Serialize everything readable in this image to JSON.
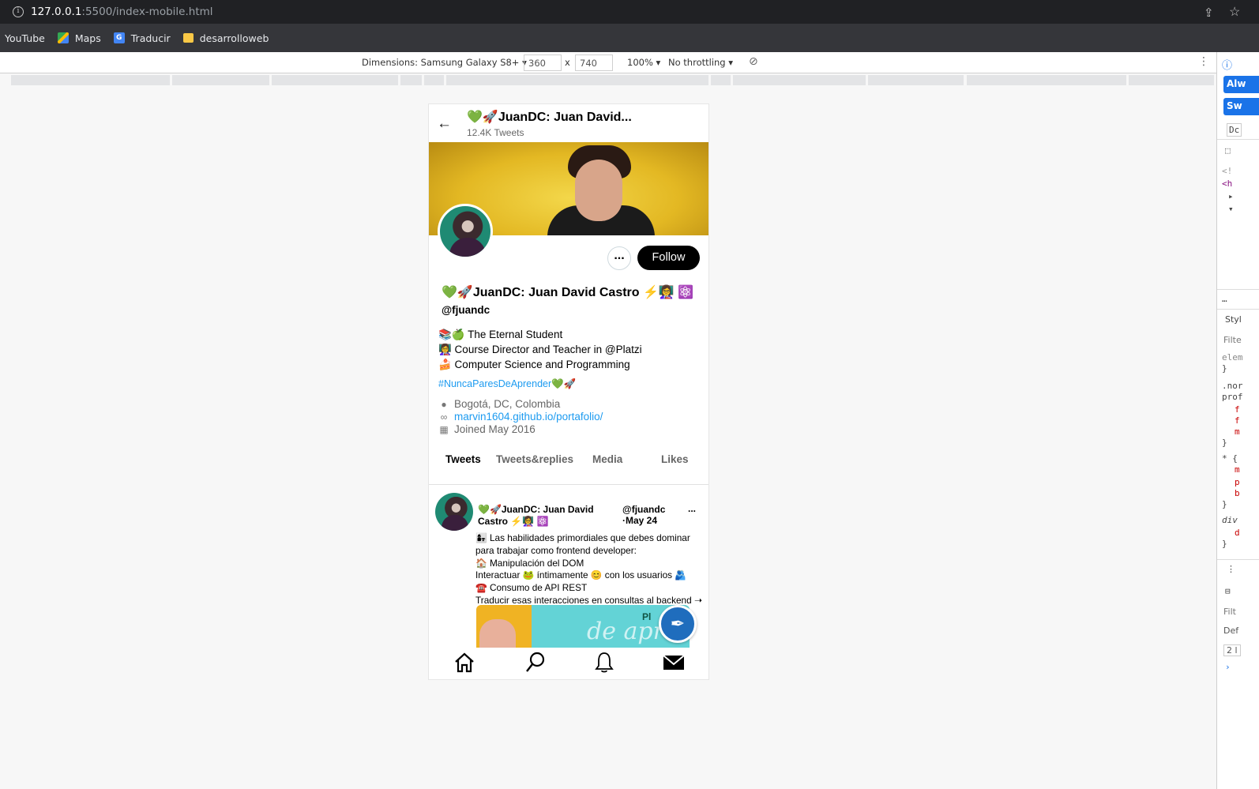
{
  "browser": {
    "url_host": "127.0.0.1",
    "url_path": ":5500/index-mobile.html",
    "bookmarks": [
      "YouTube",
      "Maps",
      "Traducir",
      "desarrolloweb"
    ]
  },
  "devtools": {
    "dimensions_label": "Dimensions: Samsung Galaxy S8+ ▾",
    "width": "360",
    "times": "x",
    "height": "740",
    "zoom": "100% ▾",
    "throttling": "No throttling ▾",
    "panel": {
      "btn1": "Alw",
      "btn2": "Sw",
      "btn3": "Dc",
      "code": [
        "<!",
        "<h",
        "▸",
        "▾"
      ],
      "styles_tab": "Styl",
      "filter": "Filte",
      "css": [
        "elem",
        "}",
        ".nor",
        "prof",
        "f",
        "f",
        "m",
        "}",
        "* {",
        "m",
        "p",
        "b",
        "}",
        "div",
        "d",
        "}"
      ],
      "filter2": "Filt",
      "def": "Def",
      "count": "2 l"
    }
  },
  "profile": {
    "header_name": "💚🚀JuanDC: Juan David...",
    "tweet_count": "12.4K Tweets",
    "more_label": "...",
    "follow_label": "Follow",
    "display_name": "💚🚀JuanDC: Juan David Castro ⚡👩‍🏫 ⚛️",
    "handle": "@fjuandc",
    "bio": [
      "📚🍏 The Eternal Student",
      "👩‍🏫 Course Director and Teacher in @Platzi",
      "🍰 Computer Science and Programming"
    ],
    "hashtag": "#NuncaParesDeAprender",
    "hashtag_emoji": "💚🚀",
    "location": "Bogotá, DC, Colombia",
    "link": "marvin1604.github.io/portafolio/",
    "joined": "Joined May 2016"
  },
  "tabs": [
    "Tweets",
    "Tweets&replies",
    "Media",
    "Likes"
  ],
  "tweet": {
    "author": "💚🚀JuanDC: Juan David Castro ⚡👩‍🏫 ⚛️",
    "handle": "@fjuandc",
    "date": "·May 24",
    "more": "...",
    "lines": [
      "👩‍👧 Las habilidades primordiales que debes dominar",
      "para trabajar como frontend developer:",
      "🏠 Manipulación del DOM",
      "Interactuar 🐸 íntimamente 😊 con los usuarios 🫂",
      "☎️ Consumo de API REST",
      "Traducir esas interacciones en consultas al backend ➝"
    ],
    "media_text": "de apre",
    "media_brand": "Pl"
  },
  "icons": {
    "fab": "feather-icon",
    "nav": [
      "home-icon",
      "search-icon",
      "bell-icon",
      "mail-icon"
    ]
  }
}
